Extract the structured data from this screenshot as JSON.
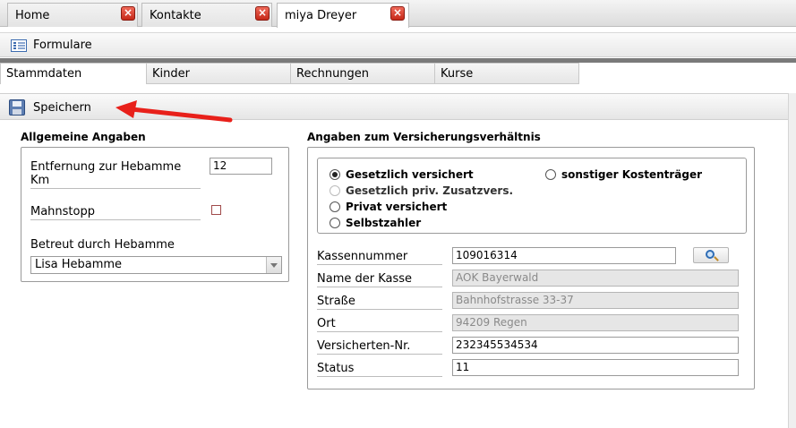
{
  "top_tabs": [
    {
      "label": "Home"
    },
    {
      "label": "Kontakte"
    },
    {
      "label": "miya Dreyer"
    }
  ],
  "toolbar": {
    "formulare_label": "Formulare",
    "save_label": "Speichern"
  },
  "sub_tabs": [
    {
      "label": "Stammdaten"
    },
    {
      "label": "Kinder"
    },
    {
      "label": "Rechnungen"
    },
    {
      "label": "Kurse"
    }
  ],
  "general": {
    "title": "Allgemeine Angaben",
    "distance_label": "Entfernung zur Hebamme Km",
    "distance_value": "12",
    "mahnstopp_label": "Mahnstopp",
    "betreut_label": "Betreut durch Hebamme",
    "betreut_value": "Lisa Hebamme"
  },
  "insurance": {
    "title": "Angaben zum Versicherungsverhältnis",
    "options": [
      "Gesetzlich versichert",
      "Gesetzlich priv. Zusatzvers.",
      "Privat versichert",
      "Selbstzahler",
      "sonstiger Kostenträger"
    ],
    "selected": "Gesetzlich versichert",
    "fields": {
      "kassennummer_label": "Kassennummer",
      "kassennummer_value": "109016314",
      "name_label": "Name der Kasse",
      "name_value": "AOK Bayerwald",
      "strasse_label": "Straße",
      "strasse_value": "Bahnhofstrasse 33-37",
      "ort_label": "Ort",
      "ort_value": "94209 Regen",
      "versicherten_label": "Versicherten-Nr.",
      "versicherten_value": "232345534534",
      "status_label": "Status",
      "status_value": "11"
    }
  },
  "colors": {
    "close_button": "#d9301e",
    "annotation_arrow": "#e8201a"
  }
}
